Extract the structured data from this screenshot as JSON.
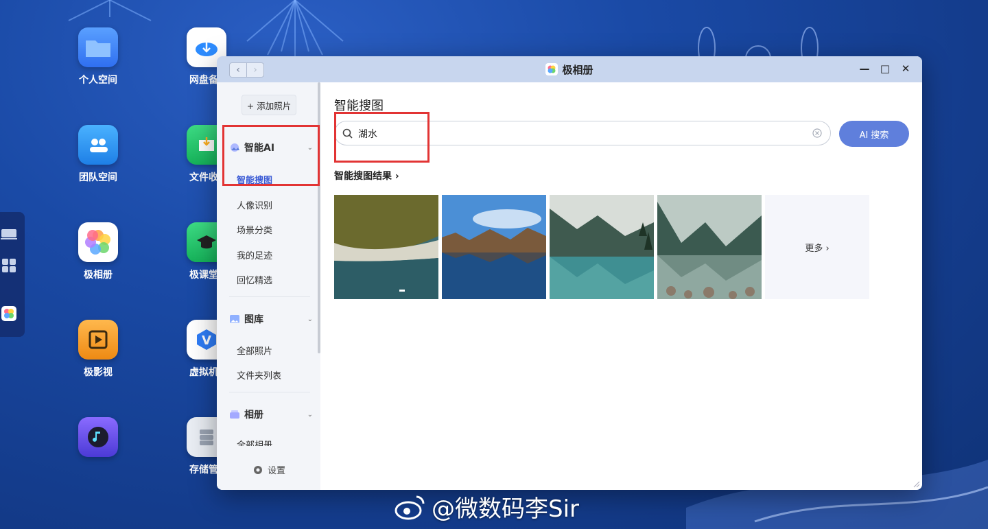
{
  "desktop": {
    "icons": [
      {
        "label": "个人空间"
      },
      {
        "label": "网盘备"
      },
      {
        "label": "团队空间"
      },
      {
        "label": "文件收"
      },
      {
        "label": "极相册"
      },
      {
        "label": "极课堂"
      },
      {
        "label": "极影视"
      },
      {
        "label": "虚拟机"
      },
      {
        "label": ""
      },
      {
        "label": "存储管"
      }
    ]
  },
  "window": {
    "title": "极相册",
    "nav_back": "‹",
    "nav_forward": "›",
    "controls": {
      "minimize": "—",
      "maximize": "□",
      "close": "✕"
    }
  },
  "sidebar": {
    "add_photo": "+ 添加照片",
    "sections": [
      {
        "title": "智能AI",
        "items": [
          "智能搜图",
          "人像识别",
          "场景分类",
          "我的足迹",
          "回忆精选"
        ]
      },
      {
        "title": "图库",
        "items": [
          "全部照片",
          "文件夹列表"
        ]
      },
      {
        "title": "相册",
        "items": [
          "全部相册"
        ]
      }
    ],
    "settings": "设置"
  },
  "main": {
    "title": "智能搜图",
    "search_value": "湖水",
    "ai_search_button": "AI 搜索",
    "results_title": "智能搜图结果 ›",
    "more": "更多 ›"
  },
  "watermark": "@微数码李Sir",
  "colors": {
    "accent": "#3b5bd5",
    "ai_button": "#5f7fdc",
    "highlight_box": "#e23434"
  }
}
